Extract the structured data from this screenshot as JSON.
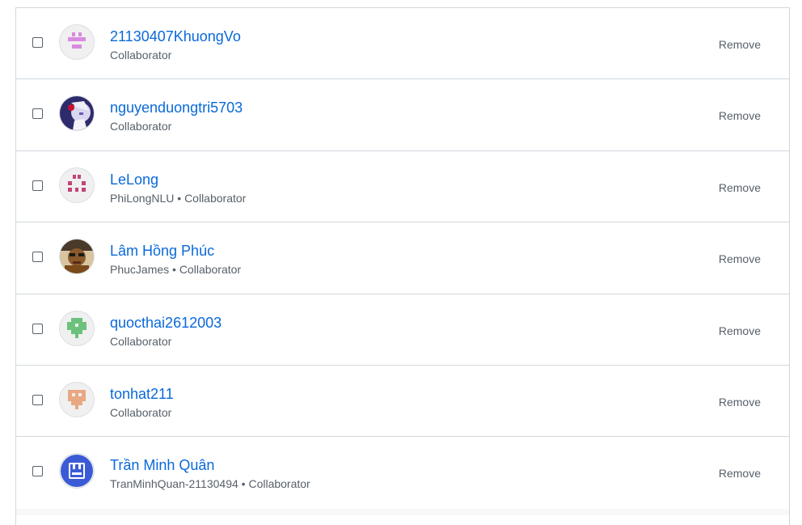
{
  "collaborators": [
    {
      "name": "21130407KhuongVo",
      "meta": "Collaborator",
      "avatar": "identicon-pink-avatar",
      "avatar_color": "#d98be0",
      "remove_label": "Remove"
    },
    {
      "name": "nguyenduongtri5703",
      "meta": "Collaborator",
      "avatar": "anime-character-avatar",
      "avatar_color": "#2d2b6b",
      "remove_label": "Remove"
    },
    {
      "name": "LeLong",
      "meta": "PhiLongNLU • Collaborator",
      "avatar": "identicon-magenta-avatar",
      "avatar_color": "#c2447a",
      "remove_label": "Remove"
    },
    {
      "name": "Lâm Hồng Phúc",
      "meta": "PhucJames • Collaborator",
      "avatar": "photo-person-avatar",
      "avatar_color": "#8a5a2b",
      "remove_label": "Remove"
    },
    {
      "name": "quocthai2612003",
      "meta": "Collaborator",
      "avatar": "identicon-green-avatar",
      "avatar_color": "#6cc27c",
      "remove_label": "Remove"
    },
    {
      "name": "tonhat211",
      "meta": "Collaborator",
      "avatar": "identicon-orange-avatar",
      "avatar_color": "#e8a882",
      "remove_label": "Remove"
    },
    {
      "name": "Trần Minh Quân",
      "meta": "TranMinhQuan-21130494 • Collaborator",
      "avatar": "blue-robot-avatar",
      "avatar_color": "#3b5bd6",
      "remove_label": "Remove"
    }
  ]
}
